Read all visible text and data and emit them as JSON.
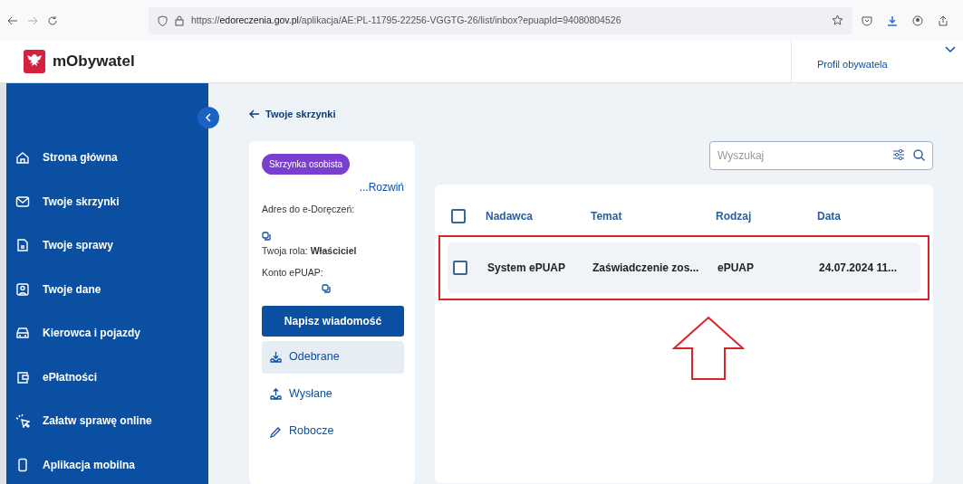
{
  "browser": {
    "url": "https://**edoreczenia.gov.pl**/aplikacja/AE:PL-11795-22256-VGGTG-26/list/inbox?epuapId=94080804526"
  },
  "header": {
    "logo_text": "mObywatel",
    "profile_link": "Profil obywatela"
  },
  "sidebar": {
    "items": [
      {
        "label": "Strona główna",
        "selected": false
      },
      {
        "label": "Twoje skrzynki",
        "selected": false
      },
      {
        "label": "Twoje sprawy",
        "selected": false
      },
      {
        "label": "Twoje dane",
        "selected": false
      },
      {
        "label": "Kierowca i pojazdy",
        "selected": false
      },
      {
        "label": "ePłatności",
        "selected": false
      },
      {
        "label": "Załatw sprawę online",
        "selected": false
      },
      {
        "label": "Aplikacja mobilna",
        "selected": false
      }
    ]
  },
  "back_link": "Twoje skrzynki",
  "mailbox": {
    "badge": "Skrzynka osobista",
    "expand_link": "...Rozwiń",
    "address_label": "Adres do e-Doręczeń:",
    "role": "Twoja rola: **Właściciel**",
    "epuap_label": "Konto ePUAP:",
    "write_button": "Napisz wiadomość",
    "folders": [
      {
        "label": "Odebrane",
        "selected": true
      },
      {
        "label": "Wysłane",
        "selected": false
      },
      {
        "label": "Robocze",
        "selected": false
      }
    ]
  },
  "search": {
    "placeholder": "Wyszukaj"
  },
  "table": {
    "select_all_checked": false,
    "columns": [
      "Nadawca",
      "Temat",
      "Rodzaj",
      "Data"
    ],
    "rows": [
      {
        "checked": false,
        "cells": [
          "System ePUAP",
          "Zaświadczenie zos...",
          "ePUAP",
          "24.07.2024 11..."
        ]
      }
    ]
  },
  "annotations": {
    "row_frame": {
      "color": "#d9232d"
    },
    "arrow": {
      "color": "#d9232d"
    }
  }
}
